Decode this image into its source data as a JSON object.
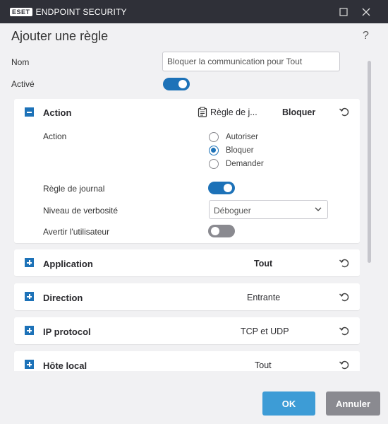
{
  "titlebar": {
    "logo_badge": "ESET",
    "product_name": "ENDPOINT SECURITY",
    "maximize_icon": "square-icon",
    "close_icon": "close-icon"
  },
  "dialog": {
    "title": "Ajouter une règle",
    "help": "?"
  },
  "form": {
    "name_label": "Nom",
    "name_value": "Bloquer la communication pour Tout",
    "enabled_label": "Activé",
    "enabled": true
  },
  "action_section": {
    "title": "Action",
    "expanded": true,
    "rule_label": "Règle de j...",
    "rule_icon": "clipboard-icon",
    "summary": "Bloquer",
    "action_label": "Action",
    "options": [
      "Autoriser",
      "Bloquer",
      "Demander"
    ],
    "selected_option": "Bloquer",
    "log_rule_label": "Règle de journal",
    "log_rule_enabled": true,
    "verbosity_label": "Niveau de verbosité",
    "verbosity_value": "Déboguer",
    "notify_label": "Avertir l'utilisateur",
    "notify_enabled": false
  },
  "sections": [
    {
      "title": "Application",
      "value": "Tout"
    },
    {
      "title": "Direction",
      "value": "Entrante"
    },
    {
      "title": "IP protocol",
      "value": "TCP et UDP"
    },
    {
      "title": "Hôte local",
      "value": "Tout"
    }
  ],
  "buttons": {
    "ok": "OK",
    "cancel": "Annuler"
  },
  "colors": {
    "accent": "#1d72b8",
    "ok_button": "#3d9cd6",
    "cancel_button": "#8a8a90",
    "titlebar": "#2f3038"
  }
}
